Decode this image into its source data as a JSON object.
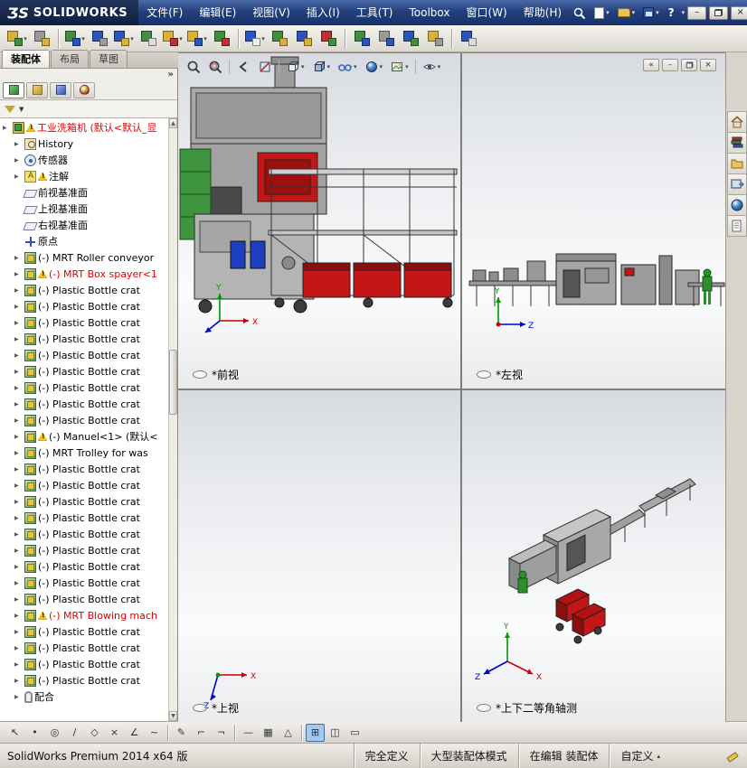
{
  "titlebar": {
    "logo_3ds": "ƷS",
    "logo_text": "SOLIDWORKS",
    "menus": [
      "文件(F)",
      "编辑(E)",
      "视图(V)",
      "插入(I)",
      "工具(T)",
      "Toolbox",
      "窗口(W)",
      "帮助(H)"
    ],
    "help_glyph": "?"
  },
  "glyphs": {
    "dropdown": "▾",
    "chevrons_left": "«",
    "minimize": "–",
    "close": "×",
    "panel_chevron": "»",
    "filter_caret": "▼",
    "scroll_up": "▲",
    "scroll_down": "▼",
    "expand_arrow": "▶",
    "custom_caret": "▴"
  },
  "toolbar": {
    "icons": [
      {
        "name": "insert-components",
        "c1": "#d9b23a",
        "c2": "#3f8f3f",
        "dd": true
      },
      {
        "name": "mate",
        "c1": "#9a9a9a",
        "c2": "#d9b23a"
      },
      {
        "sep": true
      },
      {
        "name": "linear-component-pattern",
        "c1": "#3f8f3f",
        "c2": "#2a55c0",
        "dd": true
      },
      {
        "name": "smart-fasteners",
        "c1": "#2a55c0",
        "c2": "#9a9a9a"
      },
      {
        "name": "move-component",
        "c1": "#2a55c0",
        "c2": "#d9b23a",
        "dd": true
      },
      {
        "name": "show-hidden-components",
        "c1": "#3f8f3f",
        "c2": "#dcdcdc"
      },
      {
        "name": "assembly-features",
        "c1": "#d9b23a",
        "c2": "#c03030",
        "dd": true
      },
      {
        "name": "reference-geometry",
        "c1": "#d9b23a",
        "c2": "#2a55c0",
        "dd": true
      },
      {
        "name": "new-motion-study",
        "c1": "#3f8f3f",
        "c2": "#c03030"
      },
      {
        "sep": true
      },
      {
        "name": "bill-of-materials",
        "c1": "#2a55c0",
        "c2": "#f0f0f0",
        "dd": true
      },
      {
        "name": "exploded-view",
        "c1": "#3f8f3f",
        "c2": "#d9b23a"
      },
      {
        "name": "explode-line-sketch",
        "c1": "#2a55c0",
        "c2": "#d9b23a"
      },
      {
        "name": "interference-detection",
        "c1": "#c03030",
        "c2": "#3f8f3f"
      },
      {
        "sep": true
      },
      {
        "name": "clearance-verification",
        "c1": "#3f8f3f",
        "c2": "#2a55c0"
      },
      {
        "name": "hole-alignment",
        "c1": "#9a9a9a",
        "c2": "#2a55c0"
      },
      {
        "name": "assembly-visualization",
        "c1": "#2a55c0",
        "c2": "#3f8f3f"
      },
      {
        "name": "performance-evaluation",
        "c1": "#d9b23a",
        "c2": "#9a9a9a"
      },
      {
        "sep": true
      },
      {
        "name": "instant-3d",
        "c1": "#2a55c0",
        "c2": "#dcdcdc"
      }
    ]
  },
  "tabs": [
    {
      "label": "装配体",
      "active": true
    },
    {
      "label": "布局",
      "active": false
    },
    {
      "label": "草图",
      "active": false
    }
  ],
  "tree": {
    "items": [
      {
        "label": "工业洗箱机 (默认<默认_显",
        "icon": "assembly",
        "warning": true,
        "red": true,
        "root": true,
        "expand": true
      },
      {
        "label": "History",
        "icon": "history",
        "expand": true
      },
      {
        "label": "传感器",
        "icon": "sensors",
        "expand": true
      },
      {
        "label": "注解",
        "icon": "annotations",
        "warning": true,
        "expand": true
      },
      {
        "label": "前视基准面",
        "icon": "plane"
      },
      {
        "label": "上视基准面",
        "icon": "plane"
      },
      {
        "label": "右视基准面",
        "icon": "plane"
      },
      {
        "label": "原点",
        "icon": "origin"
      },
      {
        "label": "(-) MRT Roller conveyor",
        "icon": "component",
        "expand": true
      },
      {
        "label": "(-) MRT Box spayer<1",
        "icon": "component",
        "warning": true,
        "red": true,
        "expand": true
      },
      {
        "label": "(-) Plastic Bottle crat",
        "icon": "component",
        "expand": true
      },
      {
        "label": "(-) Plastic Bottle crat",
        "icon": "component",
        "expand": true
      },
      {
        "label": "(-) Plastic Bottle crat",
        "icon": "component",
        "expand": true
      },
      {
        "label": "(-) Plastic Bottle crat",
        "icon": "component",
        "expand": true
      },
      {
        "label": "(-) Plastic Bottle crat",
        "icon": "component",
        "expand": true
      },
      {
        "label": "(-) Plastic Bottle crat",
        "icon": "component",
        "expand": true
      },
      {
        "label": "(-) Plastic Bottle crat",
        "icon": "component",
        "expand": true
      },
      {
        "label": "(-) Plastic Bottle crat",
        "icon": "component",
        "expand": true
      },
      {
        "label": "(-) Plastic Bottle crat",
        "icon": "component",
        "expand": true
      },
      {
        "label": "(-) Manuel<1> (默认<",
        "icon": "component",
        "warning": true,
        "expand": true
      },
      {
        "label": "(-) MRT Trolley for was",
        "icon": "component",
        "expand": true
      },
      {
        "label": "(-) Plastic Bottle crat",
        "icon": "component",
        "expand": true
      },
      {
        "label": "(-) Plastic Bottle crat",
        "icon": "component",
        "expand": true
      },
      {
        "label": "(-) Plastic Bottle crat",
        "icon": "component",
        "expand": true
      },
      {
        "label": "(-) Plastic Bottle crat",
        "icon": "component",
        "expand": true
      },
      {
        "label": "(-) Plastic Bottle crat",
        "icon": "component",
        "expand": true
      },
      {
        "label": "(-) Plastic Bottle crat",
        "icon": "component",
        "expand": true
      },
      {
        "label": "(-) Plastic Bottle crat",
        "icon": "component",
        "expand": true
      },
      {
        "label": "(-) Plastic Bottle crat",
        "icon": "component",
        "expand": true
      },
      {
        "label": "(-) Plastic Bottle crat",
        "icon": "component",
        "expand": true
      },
      {
        "label": "(-) MRT Blowing mach",
        "icon": "component",
        "warning": true,
        "red": true,
        "expand": true
      },
      {
        "label": "(-) Plastic Bottle crat",
        "icon": "component",
        "expand": true
      },
      {
        "label": "(-) Plastic Bottle crat",
        "icon": "component",
        "expand": true
      },
      {
        "label": "(-) Plastic Bottle crat",
        "icon": "component",
        "expand": true
      },
      {
        "label": "(-) Plastic Bottle crat",
        "icon": "component",
        "expand": true
      },
      {
        "label": "配合",
        "icon": "mates",
        "expand": true
      }
    ]
  },
  "headsup_icons": [
    "zoom-to-fit",
    "zoom-to-area",
    "previous-view",
    "section-view",
    "view-orientation",
    "display-style",
    "hide-show-items",
    "edit-appearance",
    "apply-scene",
    "view-settings"
  ],
  "viewports": [
    {
      "label": "*前视"
    },
    {
      "label": "*左视"
    },
    {
      "label": "*上视"
    },
    {
      "label": "*上下二等角轴测"
    }
  ],
  "triad": {
    "x": "X",
    "y": "Y",
    "z": "Z"
  },
  "taskpane_icons": [
    "home",
    "design-library",
    "file-explorer",
    "view-palette",
    "appearances",
    "custom-properties"
  ],
  "bottom_toolbar": {
    "icons": [
      {
        "name": "select",
        "glyph": "↖"
      },
      {
        "name": "sketch-point",
        "glyph": "•"
      },
      {
        "name": "circle",
        "glyph": "◎"
      },
      {
        "name": "line",
        "glyph": "/"
      },
      {
        "name": "polygon",
        "glyph": "◇"
      },
      {
        "name": "trim-entities",
        "glyph": "×"
      },
      {
        "name": "sketch-fillet",
        "glyph": "∠"
      },
      {
        "name": "spline",
        "glyph": "~"
      },
      {
        "sep": true
      },
      {
        "name": "sketch",
        "glyph": "✎"
      },
      {
        "name": "offset-entities",
        "glyph": "⌐"
      },
      {
        "name": "mirror-entities",
        "glyph": "¬"
      },
      {
        "sep": true
      },
      {
        "name": "smart-dimension",
        "glyph": "—"
      },
      {
        "name": "linear-sketch-pattern",
        "glyph": "▦"
      },
      {
        "name": "convert-entities",
        "glyph": "△"
      },
      {
        "sep": true
      },
      {
        "name": "four-view",
        "glyph": "⊞",
        "active": true
      },
      {
        "name": "two-view",
        "glyph": "◫"
      },
      {
        "name": "single-view",
        "glyph": "▭"
      }
    ]
  },
  "statusbar": {
    "app": "SolidWorks Premium 2014 x64 版",
    "fully_defined": "完全定义",
    "mode": "大型装配体模式",
    "editing": "在编辑 装配体",
    "custom": "自定义"
  }
}
